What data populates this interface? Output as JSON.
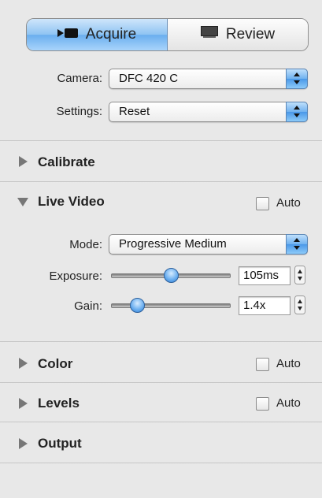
{
  "mode_toggle": {
    "acquire_label": "Acquire",
    "review_label": "Review",
    "selected": "Acquire"
  },
  "camera": {
    "label": "Camera:",
    "value": "DFC 420 C"
  },
  "settings": {
    "label": "Settings:",
    "value": "Reset"
  },
  "sections": {
    "calibrate": {
      "title": "Calibrate",
      "expanded": false
    },
    "live_video": {
      "title": "Live Video",
      "expanded": true,
      "auto_label": "Auto",
      "auto_checked": false,
      "mode": {
        "label": "Mode:",
        "value": "Progressive Medium"
      },
      "exposure": {
        "label": "Exposure:",
        "value": "105ms",
        "level": 0.5
      },
      "gain": {
        "label": "Gain:",
        "value": "1.4x",
        "level": 0.18
      }
    },
    "color": {
      "title": "Color",
      "expanded": false,
      "auto_label": "Auto",
      "auto_checked": false
    },
    "levels": {
      "title": "Levels",
      "expanded": false,
      "auto_label": "Auto",
      "auto_checked": false
    },
    "output": {
      "title": "Output",
      "expanded": false
    }
  },
  "colors": {
    "accent": "#6aaeee",
    "panel_bg": "#e8e8e8"
  }
}
